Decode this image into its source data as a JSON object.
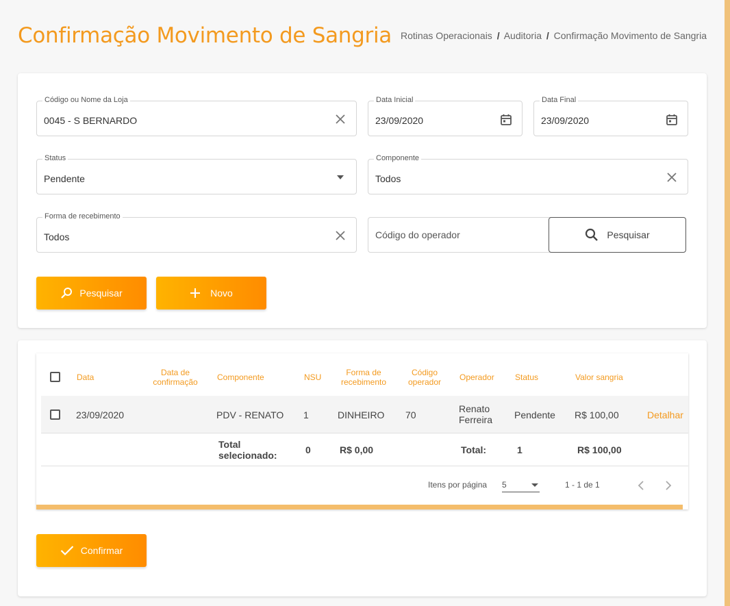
{
  "header": {
    "title": "Confirmação Movimento de Sangria",
    "breadcrumb": [
      "Rotinas Operacionais",
      "Auditoria",
      "Confirmação Movimento de Sangria"
    ],
    "separator": "/"
  },
  "filters": {
    "store": {
      "label": "Código ou Nome da Loja",
      "value": "0045 - S BERNARDO"
    },
    "start_date": {
      "label": "Data Inicial",
      "value": "23/09/2020"
    },
    "end_date": {
      "label": "Data Final",
      "value": "23/09/2020"
    },
    "status": {
      "label": "Status",
      "value": "Pendente"
    },
    "component": {
      "label": "Componente",
      "value": "Todos"
    },
    "payment_method": {
      "label": "Forma de recebimento",
      "value": "Todos"
    },
    "operator": {
      "placeholder": "Código do operador"
    },
    "operator_search_label": "Pesquisar",
    "search_label": "Pesquisar",
    "new_label": "Novo"
  },
  "table": {
    "columns": {
      "data": "Data",
      "data_confirmacao": "Data de confirmação",
      "componente": "Componente",
      "nsu": "NSU",
      "forma": "Forma de recebimento",
      "codigo_operador": "Código operador",
      "operador": "Operador",
      "status": "Status",
      "valor": "Valor sangria"
    },
    "rows": [
      {
        "data": "23/09/2020",
        "data_confirmacao": "",
        "componente": "PDV - RENATO",
        "nsu": "1",
        "forma": "DINHEIRO",
        "codigo_operador": "70",
        "operador": "Renato Ferreira",
        "status": "Pendente",
        "valor": "R$ 100,00",
        "action": "Detalhar"
      }
    ],
    "totals": {
      "selected_label": "Total selecionado:",
      "selected_count": "0",
      "selected_value": "R$ 0,00",
      "total_label": "Total:",
      "total_count": "1",
      "total_value": "R$ 100,00"
    },
    "pagination": {
      "items_per_page_label": "Itens por página",
      "items_per_page": "5",
      "range": "1 - 1 de 1"
    }
  },
  "confirm_label": "Confirmar",
  "colors": {
    "accent": "#f39a1f",
    "button_gradient_start": "#ffb300",
    "button_gradient_end": "#ff8c00"
  }
}
